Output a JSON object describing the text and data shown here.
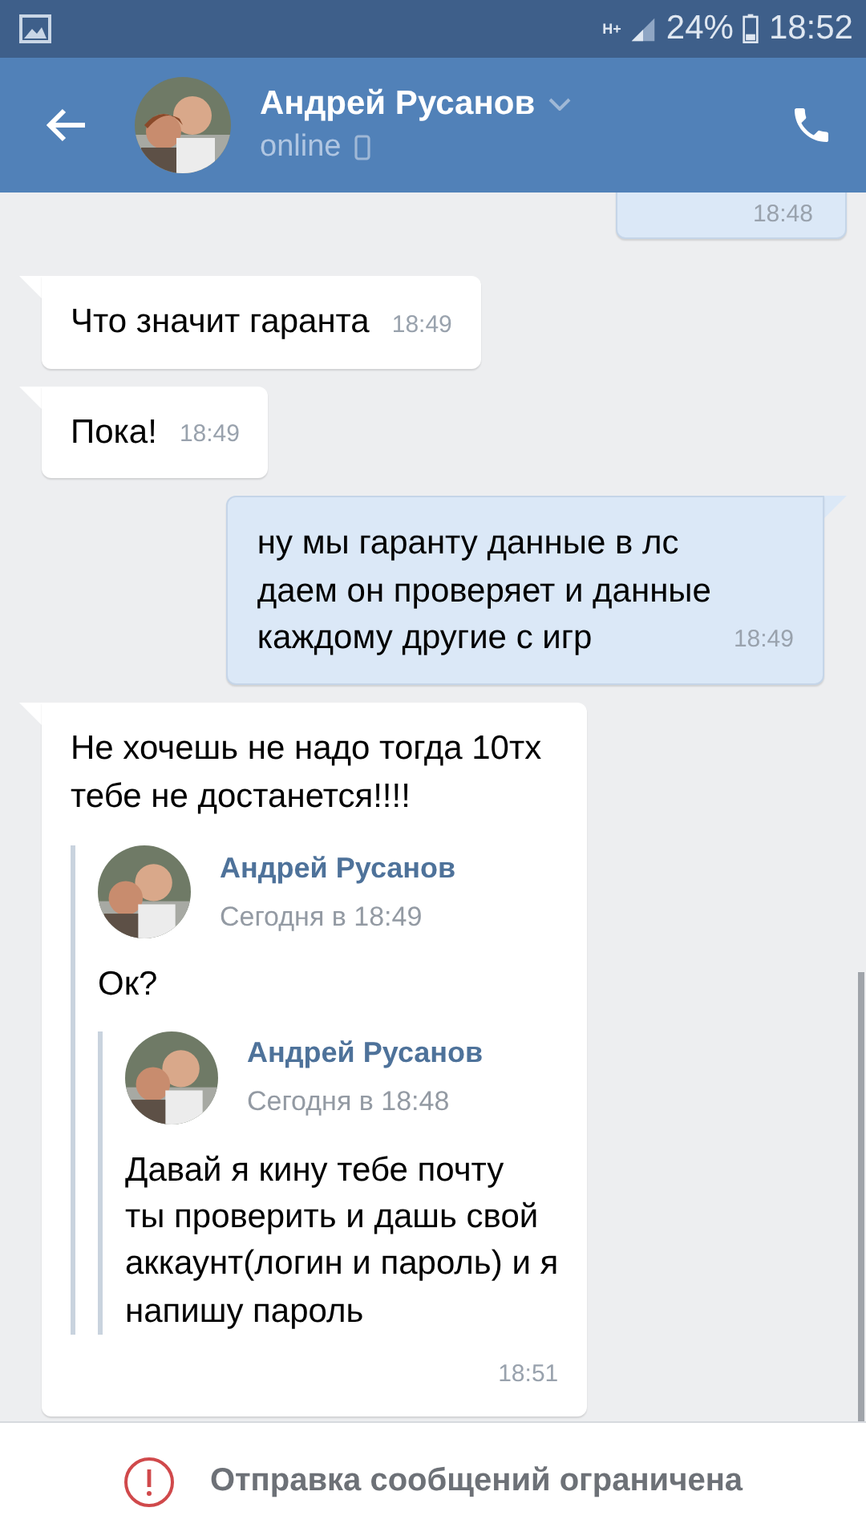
{
  "status_bar": {
    "network": "H+",
    "battery": "24%",
    "time": "18:52"
  },
  "header": {
    "name": "Андрей Русанов",
    "status": "online"
  },
  "messages": [
    {
      "kind": "partial",
      "outgoing": true,
      "time": "18:48"
    },
    {
      "kind": "text",
      "outgoing": false,
      "text": "Что значит гаранта",
      "time": "18:49"
    },
    {
      "kind": "text",
      "outgoing": false,
      "text": "Пока!",
      "time": "18:49"
    },
    {
      "kind": "text",
      "outgoing": true,
      "text": "ну мы гаранту данные  в лс\nдаем он проверяет и данные\nкаждому другие с игр",
      "time": "18:49"
    },
    {
      "kind": "forward",
      "outgoing": false,
      "text": "Не хочешь не надо тогда 10тх\nтебе не достанется!!!!",
      "time": "18:51",
      "forwarded": {
        "author": "Андрей Русанов",
        "date": "Сегодня в 18:49",
        "text": "Ок?",
        "forwarded": {
          "author": "Андрей Русанов",
          "date": "Сегодня в 18:48",
          "text": "Давай я кину тебе почту\nты проверить и дашь свой\nаккаунт(логин и пароль) и я\nнапишу пароль"
        }
      }
    }
  ],
  "footer": {
    "notice": "Отправка сообщений ограничена"
  }
}
